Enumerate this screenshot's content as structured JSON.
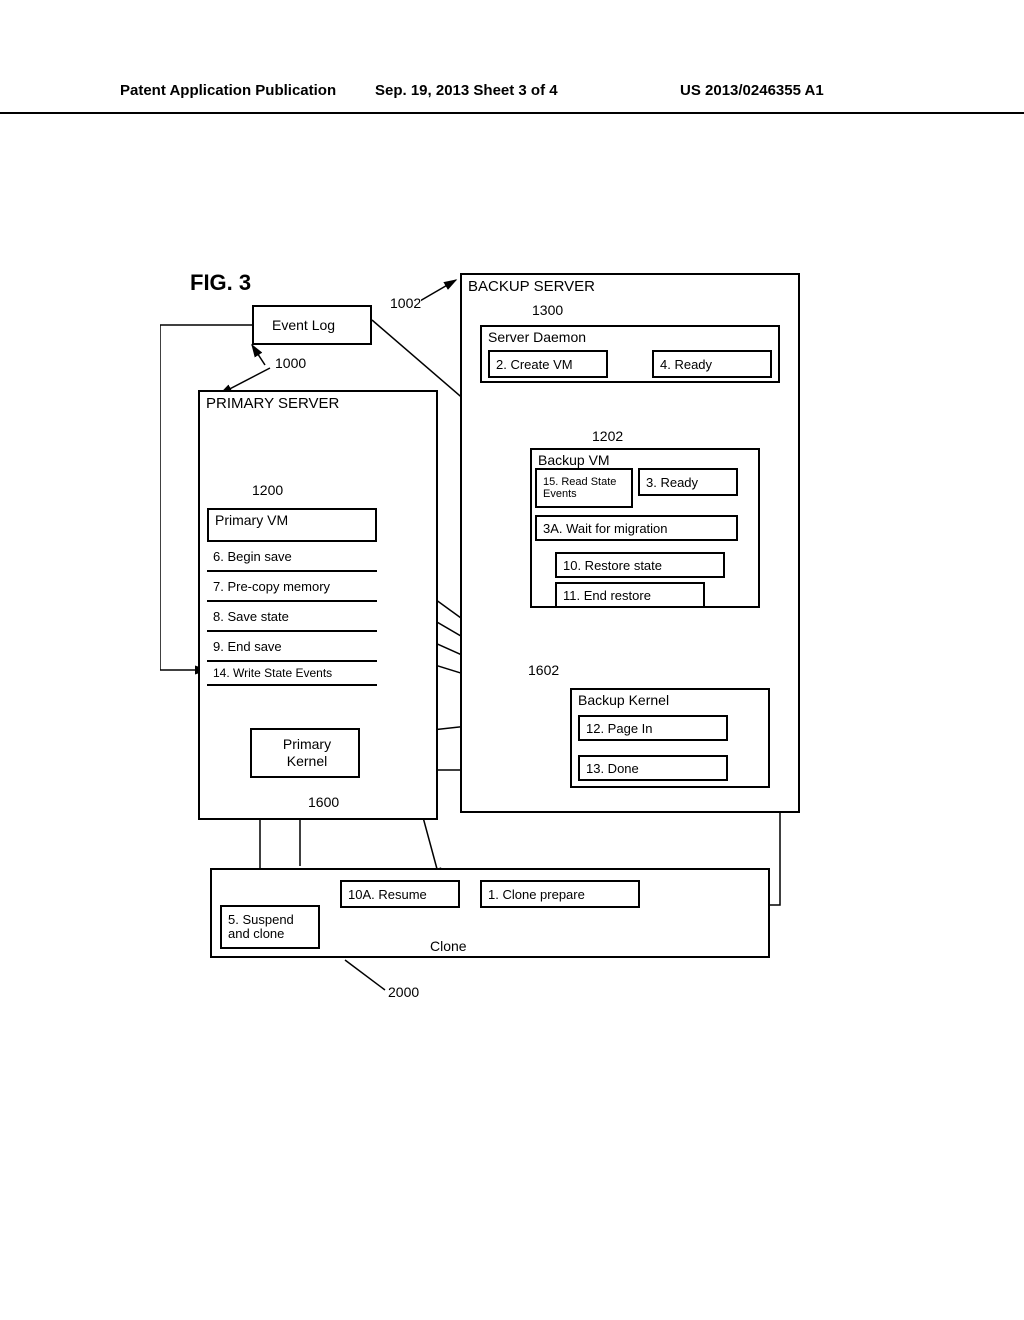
{
  "header": {
    "left": "Patent Application Publication",
    "mid": "Sep. 19, 2013  Sheet 3 of 4",
    "right": "US 2013/0246355 A1"
  },
  "fig": {
    "title": "FIG. 3",
    "event_log": "Event Log",
    "primary_server": "PRIMARY SERVER",
    "backup_server": "BACKUP SERVER",
    "server_daemon": "Server Daemon",
    "primary_vm": "Primary VM",
    "backup_vm": "Backup VM",
    "primary_kernel": "Primary Kernel",
    "backup_kernel": "Backup Kernel",
    "clone": "Clone",
    "steps": {
      "s1": "1.  Clone prepare",
      "s2": "2.  Create VM",
      "s3": "3.  Ready",
      "s3a": "3A.  Wait for migration",
      "s4": "4.  Ready",
      "s5": "5.  Suspend and clone",
      "s6": "6.  Begin save",
      "s7": "7.  Pre-copy memory",
      "s8": "8.  Save state",
      "s9": "9.  End save",
      "s10": "10.  Restore state",
      "s10a": "10A.  Resume",
      "s11": "11.  End restore",
      "s12": "12.  Page In",
      "s13": "13.  Done",
      "s14": "14.  Write State Events",
      "s15": "15.  Read State Events"
    },
    "refs": {
      "r1000": "1000",
      "r1002": "1002",
      "r1200": "1200",
      "r1202": "1202",
      "r1300": "1300",
      "r1600": "1600",
      "r1602": "1602",
      "r2000": "2000"
    }
  }
}
